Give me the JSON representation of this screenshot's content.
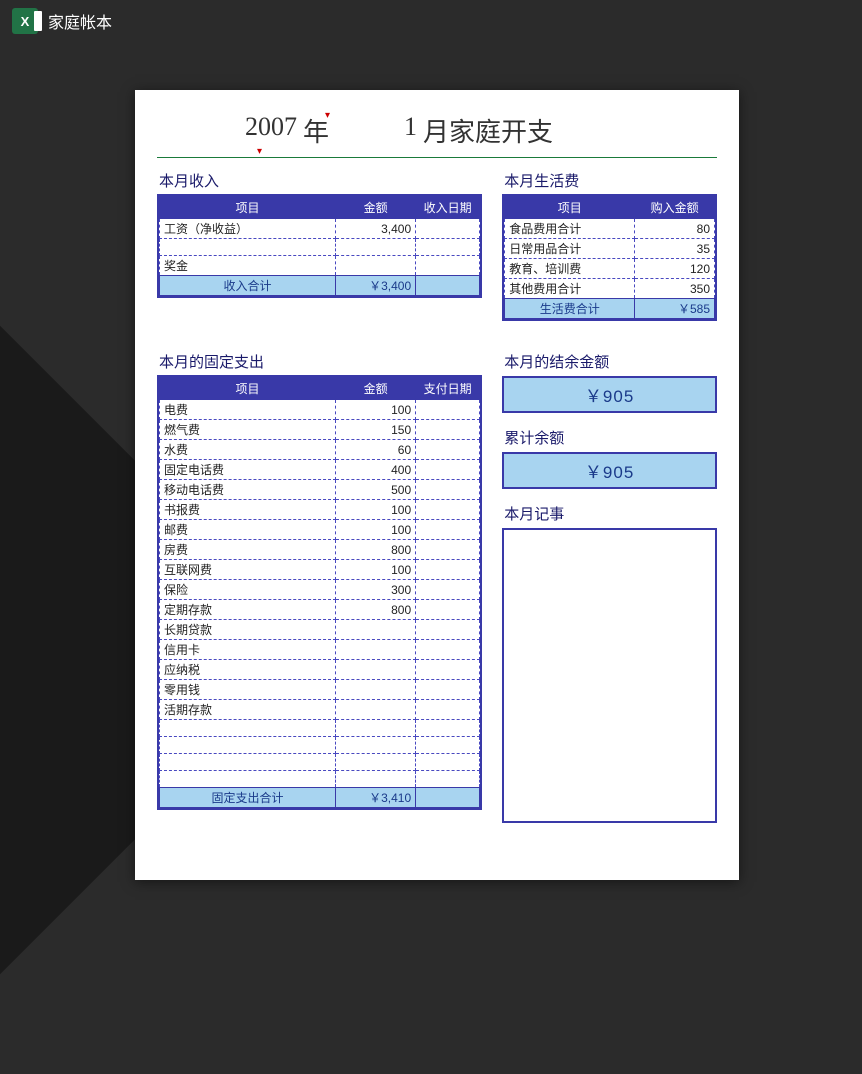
{
  "app": {
    "title": "家庭帐本"
  },
  "title": {
    "year": "2007",
    "year_label": "年",
    "month": "1",
    "rest": "月家庭开支"
  },
  "income": {
    "section": "本月收入",
    "headers": [
      "项目",
      "金额",
      "收入日期"
    ],
    "rows": [
      {
        "item": "工资（净收益）",
        "amount": "3,400",
        "date": ""
      },
      {
        "item": "",
        "amount": "",
        "date": ""
      },
      {
        "item": "奖金",
        "amount": "",
        "date": ""
      }
    ],
    "total_label": "收入合计",
    "total_value": "￥3,400"
  },
  "life": {
    "section": "本月生活费",
    "headers": [
      "项目",
      "购入金额"
    ],
    "rows": [
      {
        "item": "食品费用合计",
        "amount": "80"
      },
      {
        "item": "日常用品合计",
        "amount": "35"
      },
      {
        "item": "教育、培训费",
        "amount": "120"
      },
      {
        "item": "其他费用合计",
        "amount": "350"
      }
    ],
    "total_label": "生活费合计",
    "total_value": "￥585"
  },
  "fixed": {
    "section": "本月的固定支出",
    "headers": [
      "项目",
      "金额",
      "支付日期"
    ],
    "rows": [
      {
        "item": "电费",
        "amount": "100",
        "date": ""
      },
      {
        "item": "燃气费",
        "amount": "150",
        "date": ""
      },
      {
        "item": "水费",
        "amount": "60",
        "date": ""
      },
      {
        "item": "固定电话费",
        "amount": "400",
        "date": ""
      },
      {
        "item": "移动电话费",
        "amount": "500",
        "date": ""
      },
      {
        "item": "书报费",
        "amount": "100",
        "date": ""
      },
      {
        "item": "邮费",
        "amount": "100",
        "date": ""
      },
      {
        "item": "房费",
        "amount": "800",
        "date": ""
      },
      {
        "item": "互联网费",
        "amount": "100",
        "date": ""
      },
      {
        "item": "保险",
        "amount": "300",
        "date": ""
      },
      {
        "item": "定期存款",
        "amount": "800",
        "date": ""
      },
      {
        "item": "长期贷款",
        "amount": "",
        "date": ""
      },
      {
        "item": "信用卡",
        "amount": "",
        "date": ""
      },
      {
        "item": "应纳税",
        "amount": "",
        "date": ""
      },
      {
        "item": "零用钱",
        "amount": "",
        "date": ""
      },
      {
        "item": "活期存款",
        "amount": "",
        "date": ""
      },
      {
        "item": "",
        "amount": "",
        "date": ""
      },
      {
        "item": "",
        "amount": "",
        "date": ""
      },
      {
        "item": "",
        "amount": "",
        "date": ""
      },
      {
        "item": "",
        "amount": "",
        "date": ""
      }
    ],
    "total_label": "固定支出合计",
    "total_value": "￥3,410"
  },
  "balance": {
    "month_label": "本月的结余金额",
    "month_value": "￥905",
    "cumulative_label": "累计余额",
    "cumulative_value": "￥905"
  },
  "notes": {
    "label": "本月记事"
  }
}
